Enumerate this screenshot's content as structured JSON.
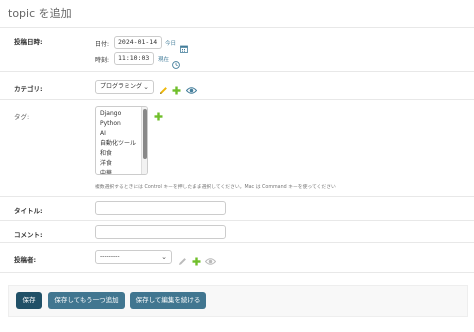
{
  "page": {
    "title": "topic を追加"
  },
  "fields": {
    "posted_at": {
      "label": "投稿日時:",
      "date_label": "日付:",
      "date_value": "2024-01-14",
      "today_link": "今日",
      "time_label": "時刻:",
      "time_value": "11:10:03",
      "now_link": "現在"
    },
    "category": {
      "label": "カテゴリ:",
      "selected": "プログラミング"
    },
    "tags": {
      "label": "タグ:",
      "options": [
        "Django",
        "Python",
        "AI",
        "自動化ツール",
        "和食",
        "洋食",
        "中華"
      ],
      "help_text": "複数選択するときには Control キーを押したまま選択してください。Mac は Command キーを使ってください"
    },
    "title": {
      "label": "タイトル:",
      "value": ""
    },
    "comment": {
      "label": "コメント:",
      "value": ""
    },
    "poster": {
      "label": "投稿者:",
      "selected": "---------"
    }
  },
  "actions": {
    "save": "保存",
    "save_add_another": "保存してもう一つ追加",
    "save_continue": "保存して編集を続ける"
  },
  "colors": {
    "primary_button": "#205067",
    "button": "#417690",
    "add_icon": "#70bf2b",
    "edit_icon": "#efb80b",
    "view_icon": "#447e9b"
  }
}
